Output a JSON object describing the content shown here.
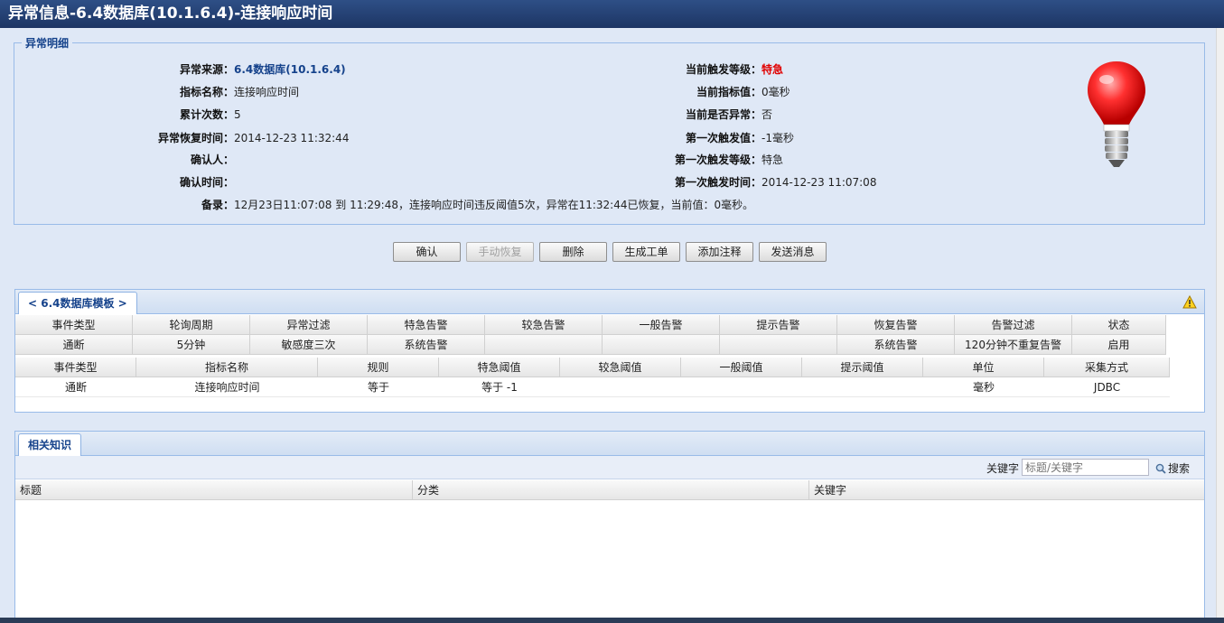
{
  "title": "异常信息-6.4数据库(10.1.6.4)-连接响应时间",
  "detail": {
    "legend": "异常明细",
    "left": [
      {
        "label": "异常来源：",
        "value": "6.4数据库(10.1.6.4)",
        "style": "link"
      },
      {
        "label": "指标名称：",
        "value": "连接响应时间",
        "style": ""
      },
      {
        "label": "累计次数：",
        "value": "5",
        "style": ""
      },
      {
        "label": "异常恢复时间：",
        "value": "2014-12-23 11:32:44",
        "style": ""
      },
      {
        "label": "确认人：",
        "value": "",
        "style": ""
      },
      {
        "label": "确认时间：",
        "value": "",
        "style": ""
      }
    ],
    "right": [
      {
        "label": "当前触发等级：",
        "value": "特急",
        "style": "red"
      },
      {
        "label": "当前指标值：",
        "value": "0毫秒",
        "style": ""
      },
      {
        "label": "当前是否异常：",
        "value": "否",
        "style": ""
      },
      {
        "label": "第一次触发值：",
        "value": "-1毫秒",
        "style": ""
      },
      {
        "label": "第一次触发等级：",
        "value": "特急",
        "style": ""
      },
      {
        "label": "第一次触发时间：",
        "value": "2014-12-23 11:07:08",
        "style": ""
      }
    ],
    "remark_label": "备录：",
    "remark_value": "12月23日11:07:08 到 11:29:48，连接响应时间违反阈值5次，异常在11:32:44已恢复，当前值：0毫秒。",
    "bulb_icon": "red-light-bulb-icon",
    "bulb_color": "#ff2b2b"
  },
  "buttons": [
    {
      "label": "确认",
      "disabled": false
    },
    {
      "label": "手动恢复",
      "disabled": true
    },
    {
      "label": "删除",
      "disabled": false
    },
    {
      "label": "生成工单",
      "disabled": false
    },
    {
      "label": "添加注释",
      "disabled": false
    },
    {
      "label": "发送消息",
      "disabled": false
    }
  ],
  "template": {
    "tab_label": "< 6.4数据库模板 >",
    "warning_icon": "warning-icon",
    "events_header": [
      "事件类型",
      "轮询周期",
      "异常过滤",
      "特急告警",
      "较急告警",
      "一般告警",
      "提示告警",
      "恢复告警",
      "告警过滤",
      "状态"
    ],
    "events_row": [
      "通断",
      "5分钟",
      "敏感度三次",
      "系统告警",
      "",
      "",
      "",
      "系统告警",
      "120分钟不重复告警",
      "启用"
    ],
    "metrics_header": [
      "事件类型",
      "指标名称",
      "规则",
      "特急阈值",
      "较急阈值",
      "一般阈值",
      "提示阈值",
      "单位",
      "采集方式"
    ],
    "metrics_row": [
      "通断",
      "连接响应时间",
      "等于",
      "等于 -1",
      "",
      "",
      "",
      "毫秒",
      "JDBC"
    ]
  },
  "knowledge": {
    "tab_label": "相关知识",
    "keyword_label": "关键字",
    "keyword_placeholder": "标题/关键字",
    "search_label": "搜索",
    "search_icon": "magnifier-icon",
    "columns": [
      "标题",
      "分类",
      "关键字"
    ]
  }
}
